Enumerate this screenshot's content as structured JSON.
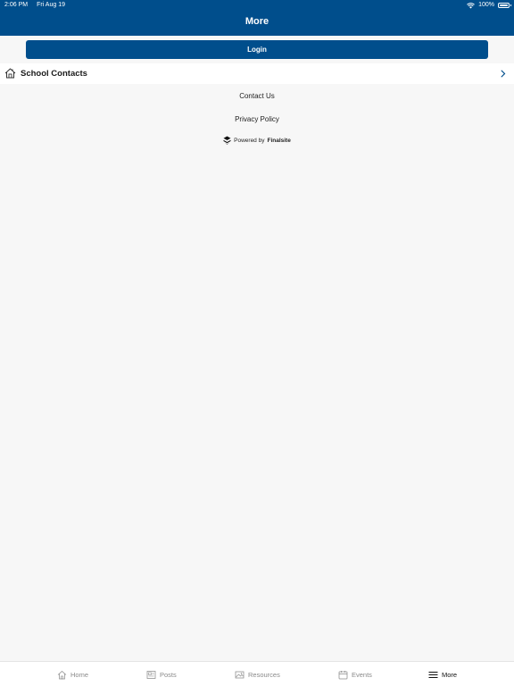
{
  "status_bar": {
    "time": "2:06 PM",
    "date": "Fri Aug 19",
    "battery": "100%"
  },
  "header": {
    "title": "More"
  },
  "login": {
    "label": "Login"
  },
  "contacts_row": {
    "label": "School Contacts",
    "icon": "house-icon"
  },
  "links": {
    "contact_us": "Contact Us",
    "privacy_policy": "Privacy Policy"
  },
  "powered_by": {
    "prefix": "Powered by",
    "brand": "Finalsite"
  },
  "tabs": [
    {
      "label": "Home",
      "icon": "home-icon",
      "active": false
    },
    {
      "label": "Posts",
      "icon": "posts-icon",
      "active": false
    },
    {
      "label": "Resources",
      "icon": "resources-icon",
      "active": false
    },
    {
      "label": "Events",
      "icon": "calendar-icon",
      "active": false
    },
    {
      "label": "More",
      "icon": "menu-icon",
      "active": true
    }
  ],
  "colors": {
    "brand_blue": "#004e8c",
    "background": "#f7f7f7",
    "active_tab": "#111111",
    "inactive_tab": "#8a8a8a"
  }
}
